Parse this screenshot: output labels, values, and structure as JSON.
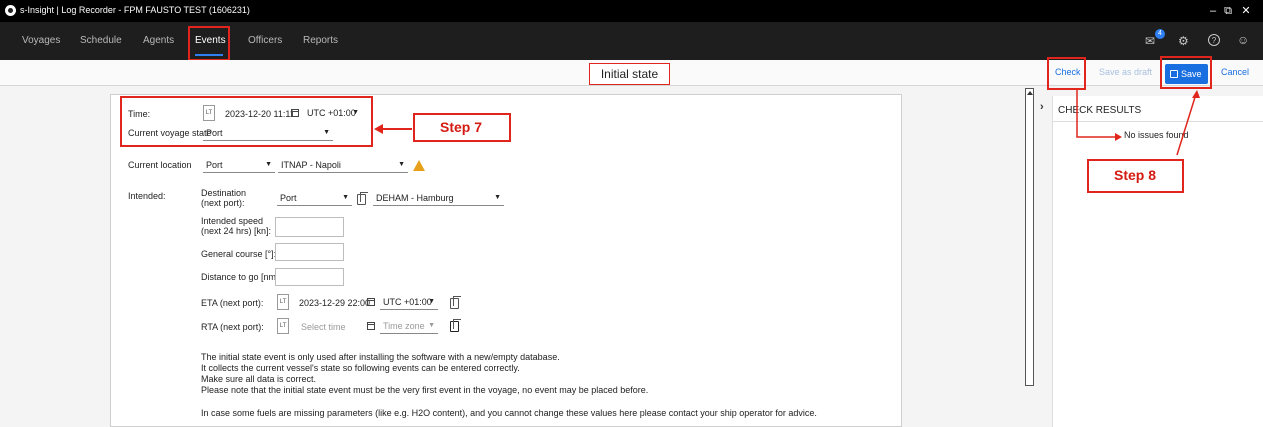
{
  "titlebar": {
    "title": "s-Insight | Log Recorder - FPM FAUSTO TEST (1606231)",
    "min": "–",
    "restore": "⧉",
    "close": "✕"
  },
  "nav": {
    "items": [
      "Voyages",
      "Schedule",
      "Agents",
      "Events",
      "Officers",
      "Reports"
    ],
    "active": "Events",
    "badge": "4"
  },
  "toolbar": {
    "heading": "Initial state",
    "check": "Check",
    "save_draft": "Save as draft",
    "save": "Save",
    "cancel": "Cancel"
  },
  "form": {
    "time_label": "Time:",
    "lt": "LT",
    "time_value": "2023-12-20 11:11",
    "tz_value": "UTC +01:00",
    "voyage_state_label": "Current voyage state",
    "voyage_state_value": "Port",
    "location_label": "Current location",
    "location_type": "Port",
    "location_value": "ITNAP - Napoli",
    "intended_label": "Intended:",
    "destination_label_1": "Destination",
    "destination_label_2": "(next port):",
    "dest_type": "Port",
    "dest_value": "DEHAM - Hamburg",
    "speed_label_1": "Intended speed",
    "speed_label_2": "(next 24 hrs) [kn]:",
    "course_label": "General course [°]:",
    "distance_label": "Distance to go [nm]:",
    "eta_label": "ETA (next port):",
    "eta_value": "2023-12-29 22:00",
    "eta_tz": "UTC +01:00",
    "rta_label": "RTA (next port):",
    "rta_placeholder": "Select time",
    "rta_tz_placeholder": "Time zone",
    "info": [
      "The initial state event is only used after installing the software with a new/empty database.",
      "It collects the current vessel's state so following events can be entered correctly.",
      "Make sure all data is correct.",
      "Please note that the initial state event must be the very first event in the voyage, no event may be placed before.",
      "In case some fuels are missing parameters (like e.g. H2O content), and you cannot change these values here please contact your ship operator for advice."
    ]
  },
  "check_results": {
    "title": "CHECK RESULTS",
    "message": "No issues found"
  },
  "annotations": {
    "step7": "Step 7",
    "step8": "Step 8"
  },
  "colors": {
    "accent": "#1a6fe0",
    "annotation": "#e0261c",
    "warning": "#e6a01a"
  }
}
